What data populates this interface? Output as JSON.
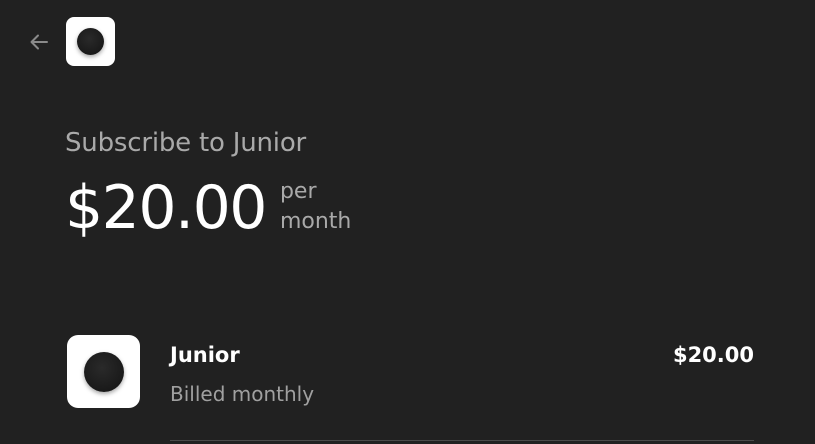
{
  "header": {
    "back_icon": "arrow-left-icon",
    "logo_icon": "app-logo-icon"
  },
  "summary": {
    "title": "Subscribe to Junior",
    "price": "$20.00",
    "period": "per\nmonth"
  },
  "line_item": {
    "logo_icon": "app-logo-icon",
    "name": "Junior",
    "billing": "Billed monthly",
    "price": "$20.00"
  },
  "colors": {
    "background": "#212121",
    "primary_text": "#ffffff",
    "secondary_text": "#a9a9a9"
  }
}
